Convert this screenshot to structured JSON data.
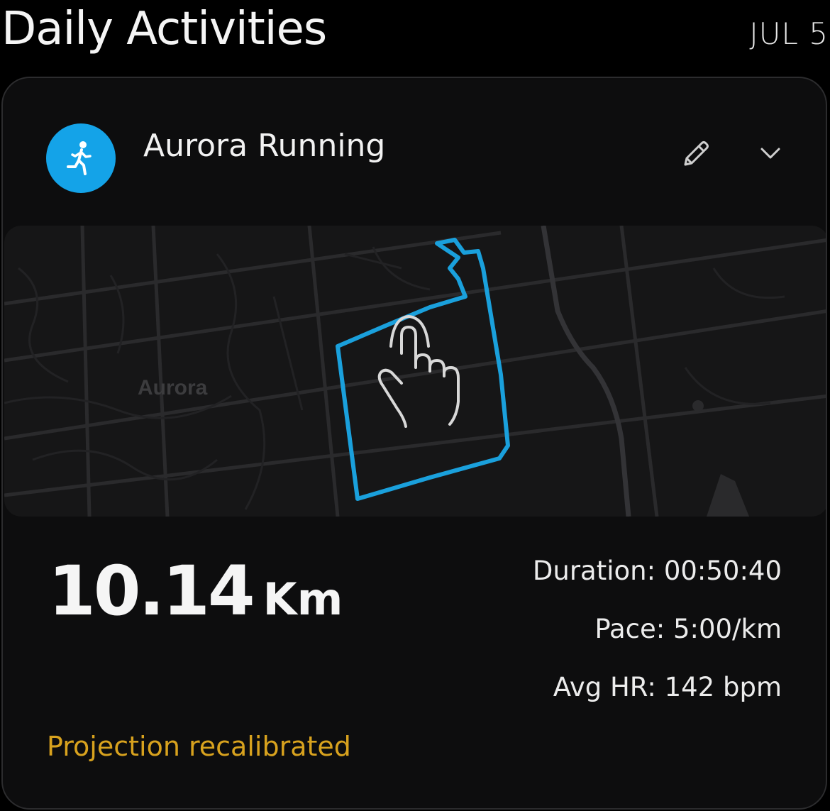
{
  "header": {
    "title": "Daily Activities",
    "date": "JUL 5"
  },
  "activity": {
    "name": "Aurora Running",
    "icon": "running-person-icon",
    "icon_color": "#14a3e8",
    "map": {
      "place_label": "Aurora",
      "route_color": "#1aa0dc"
    },
    "distance": {
      "value": "10.14",
      "unit": "Km"
    },
    "stats": {
      "duration": "Duration: 00:50:40",
      "pace": "Pace: 5:00/km",
      "avg_hr": "Avg HR: 142 bpm"
    },
    "status": "Projection recalibrated",
    "status_color": "#d8a21e"
  }
}
